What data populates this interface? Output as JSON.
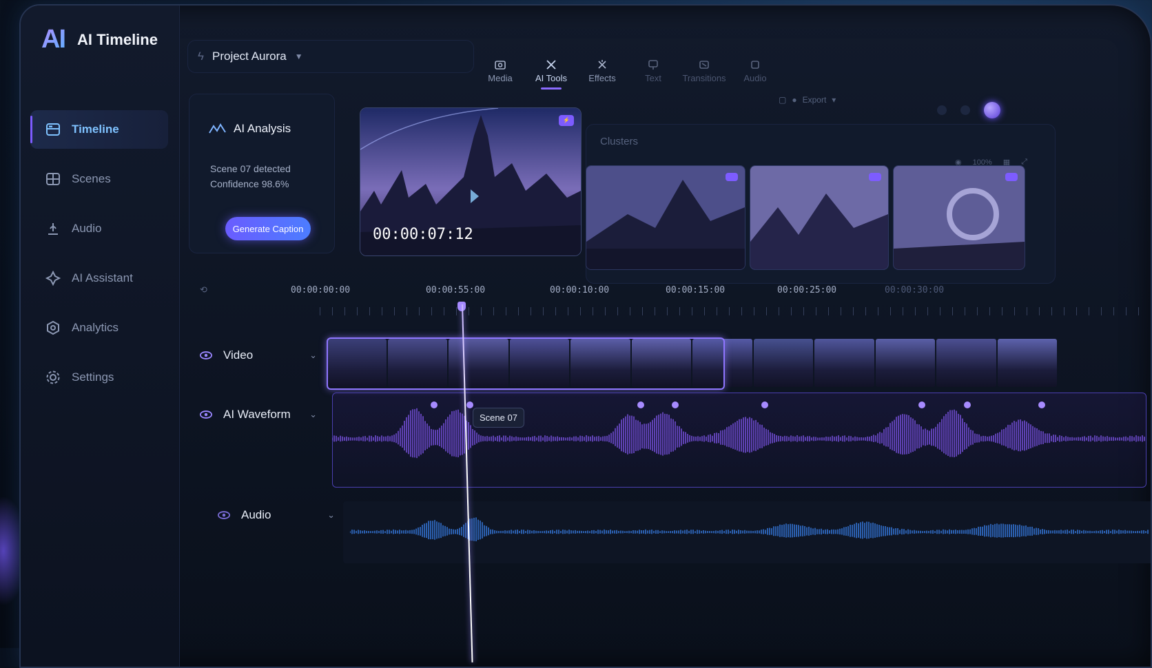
{
  "app": {
    "logo": "AI",
    "name": "AI Timeline"
  },
  "sidebar": {
    "items": [
      {
        "label": "Timeline",
        "icon": "timeline-icon",
        "active": true
      },
      {
        "label": "Scenes",
        "icon": "scenes-icon",
        "active": false
      },
      {
        "label": "Audio",
        "icon": "audio-icon",
        "active": false
      },
      {
        "label": "AI Assistant",
        "icon": "ai-assistant-icon",
        "active": false
      },
      {
        "label": "Analytics",
        "icon": "analytics-icon",
        "active": false
      },
      {
        "label": "Settings",
        "icon": "gear-icon",
        "active": false
      }
    ]
  },
  "project": {
    "name": "Project Aurora"
  },
  "toolbar": {
    "items": [
      {
        "label": "Media",
        "icon": "media-icon"
      },
      {
        "label": "AI Tools",
        "icon": "ai-tools-icon",
        "active": true
      },
      {
        "label": "Effects",
        "icon": "effects-icon"
      },
      {
        "label": "Text",
        "icon": "text-icon"
      },
      {
        "label": "Transitions",
        "icon": "transitions-icon"
      },
      {
        "label": "Audio",
        "icon": "audio-icon"
      }
    ],
    "export_label": "Export"
  },
  "analysis": {
    "title": "AI Analysis",
    "line1": "Scene 07 detected",
    "line2": "Confidence 98.6%",
    "button": "Generate Caption"
  },
  "preview": {
    "timecode": "00:00:07:12"
  },
  "gallery": {
    "label": "Clusters",
    "zoom": "100%"
  },
  "ruler": {
    "labels": [
      "00:00:00:00",
      "00:00:55:00",
      "00:00:10:00",
      "00:00:15:00",
      "00:00:25:00",
      "00:00:30:00"
    ]
  },
  "tracks": {
    "video": "Video",
    "waveform": "AI Waveform",
    "audio": "Audio"
  },
  "scene_tag": "Scene 07",
  "colors": {
    "accent": "#7c5cff",
    "waveform": "#8a5cff",
    "audio_wave": "#3d8bff",
    "active_nav": "#7fc2ff"
  }
}
